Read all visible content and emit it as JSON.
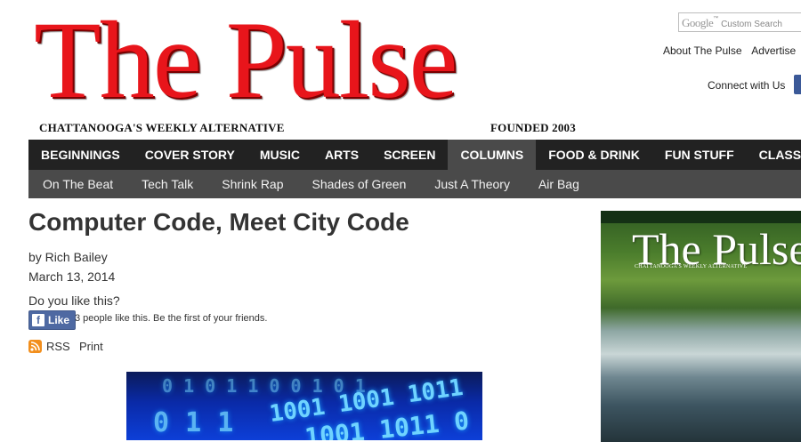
{
  "masthead": {
    "logo": "The Pulse",
    "tagline": "CHATTANOOGA'S WEEKLY ALTERNATIVE",
    "founded": "FOUNDED 2003"
  },
  "search": {
    "brand": "Google",
    "placeholder": "Custom Search"
  },
  "top_links": [
    "About The Pulse",
    "Advertise"
  ],
  "connect_label": "Connect with Us",
  "nav": {
    "main": [
      {
        "label": "BEGINNINGS",
        "active": false
      },
      {
        "label": "COVER STORY",
        "active": false
      },
      {
        "label": "MUSIC",
        "active": false
      },
      {
        "label": "ARTS",
        "active": false
      },
      {
        "label": "SCREEN",
        "active": false
      },
      {
        "label": "COLUMNS",
        "active": true
      },
      {
        "label": "FOOD & DRINK",
        "active": false
      },
      {
        "label": "FUN STUFF",
        "active": false
      },
      {
        "label": "CLASSIF",
        "active": false
      }
    ],
    "sub": [
      "On The Beat",
      "Tech Talk",
      "Shrink Rap",
      "Shades of Green",
      "Just A Theory",
      "Air Bag"
    ]
  },
  "article": {
    "title": "Computer Code, Meet City Code",
    "byline": "by Rich Bailey",
    "date": "March 13, 2014",
    "like_question": "Do you like this?",
    "like_button": "Like",
    "like_text": "3 people like this. Be the first of your friends.",
    "rss_label": "RSS",
    "print_label": "Print"
  },
  "colors": {
    "logo_red": "#e8151b",
    "nav_dark": "#222222",
    "nav_sub": "#4a4a4a",
    "facebook_blue": "#4e69a2",
    "rss_orange": "#f28f1d"
  }
}
